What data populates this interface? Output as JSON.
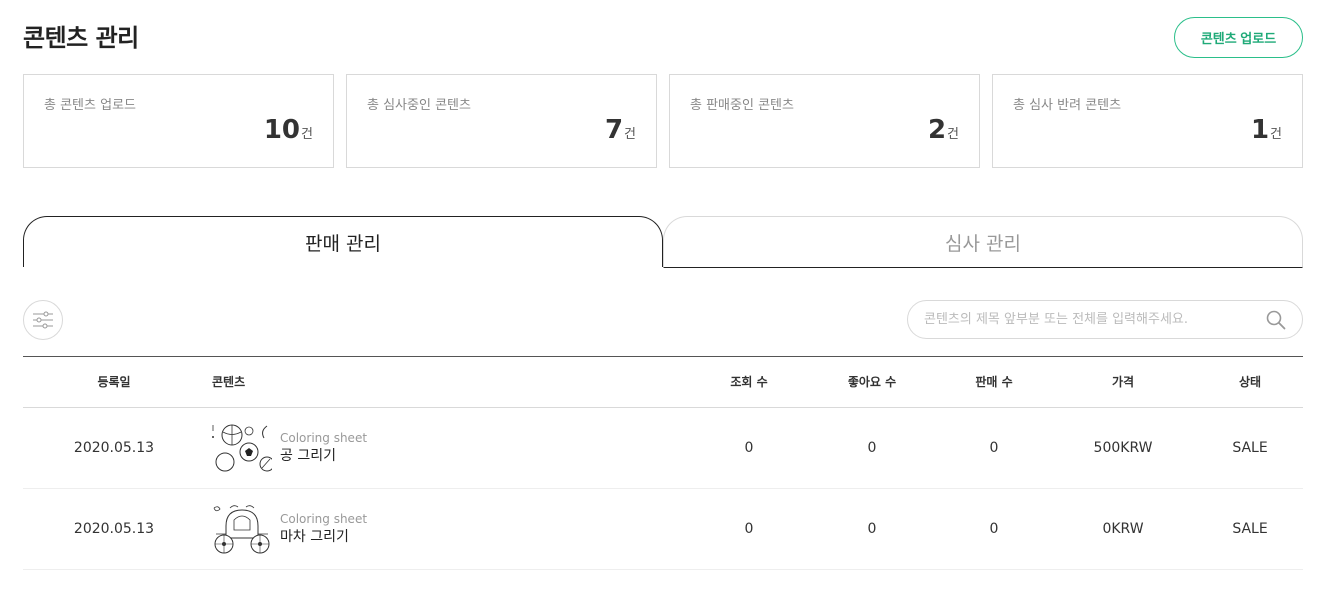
{
  "header": {
    "title": "콘텐츠 관리",
    "upload_label": "콘텐츠 업로드"
  },
  "stats": [
    {
      "label": "총 콘텐츠 업로드",
      "value": "10",
      "unit": "건"
    },
    {
      "label": "총 심사중인 콘텐츠",
      "value": "7",
      "unit": "건"
    },
    {
      "label": "총 판매중인 콘텐츠",
      "value": "2",
      "unit": "건"
    },
    {
      "label": "총 심사 반려 콘텐츠",
      "value": "1",
      "unit": "건"
    }
  ],
  "tabs": [
    {
      "label": "판매 관리",
      "active": true
    },
    {
      "label": "심사 관리",
      "active": false
    }
  ],
  "search": {
    "placeholder": "콘텐츠의 제목 앞부분 또는 전체를 입력해주세요.",
    "value": ""
  },
  "table": {
    "headers": {
      "date": "등록일",
      "content": "콘텐츠",
      "views": "조회 수",
      "likes": "좋아요 수",
      "sales": "판매 수",
      "price": "가격",
      "status": "상태"
    },
    "rows": [
      {
        "date": "2020.05.13",
        "category": "Coloring sheet",
        "name": "공 그리기",
        "views": "0",
        "likes": "0",
        "sales": "0",
        "price": "500KRW",
        "status": "SALE"
      },
      {
        "date": "2020.05.13",
        "category": "Coloring sheet",
        "name": "마차 그리기",
        "views": "0",
        "likes": "0",
        "sales": "0",
        "price": "0KRW",
        "status": "SALE"
      }
    ]
  },
  "colors": {
    "accent": "#1faa78",
    "accent_border": "#2bbf8a"
  }
}
